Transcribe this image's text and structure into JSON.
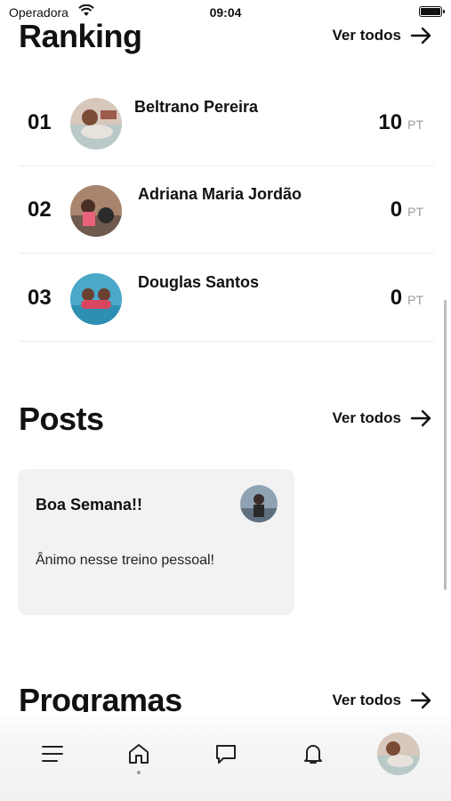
{
  "status_bar": {
    "carrier": "Operadora",
    "time": "09:04"
  },
  "ranking": {
    "title": "Ranking",
    "see_all": "Ver todos",
    "entries": [
      {
        "position": "01",
        "name": "Beltrano Pereira",
        "points": "10",
        "unit": "PT"
      },
      {
        "position": "02",
        "name": "Adriana Maria Jordão",
        "points": "0",
        "unit": "PT"
      },
      {
        "position": "03",
        "name": "Douglas Santos",
        "points": "0",
        "unit": "PT"
      }
    ]
  },
  "posts": {
    "title": "Posts",
    "see_all": "Ver todos",
    "items": [
      {
        "title": "Boa Semana!!",
        "body": "Ânimo nesse treino pessoal!"
      }
    ]
  },
  "programs": {
    "title": "Programas",
    "see_all": "Ver todos"
  },
  "tab_bar": {
    "tabs": [
      "menu-icon",
      "home-icon",
      "chat-icon",
      "bell-icon",
      "profile-avatar"
    ],
    "active": "home-icon"
  }
}
